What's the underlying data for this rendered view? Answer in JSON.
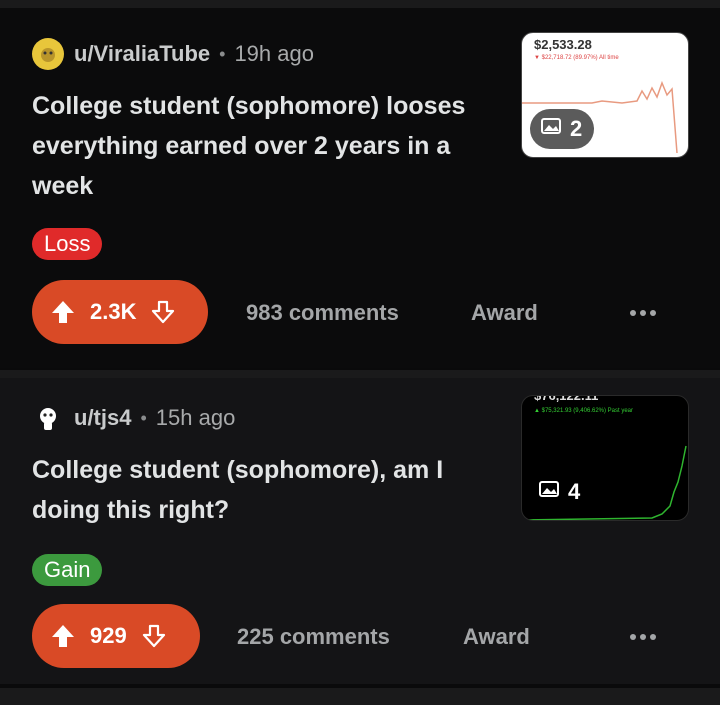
{
  "posts": [
    {
      "username": "u/ViraliaTube",
      "time": "19h ago",
      "title": "College student (sophomore) looses everything earned over 2 years in a week",
      "flair": "Loss",
      "votes": "2.3K",
      "comments": "983 comments",
      "award": "Award",
      "thumbnail": {
        "price": "$2,533.28",
        "change": "▼ $22,718.72 (89.97%) All time",
        "image_count": "2"
      }
    },
    {
      "username": "u/tjs4",
      "time": "15h ago",
      "title": "College student (sophomore), am I doing this right?",
      "flair": "Gain",
      "votes": "929",
      "comments": "225 comments",
      "award": "Award",
      "thumbnail": {
        "price": "$76,122.11",
        "change": "▲ $75,321.93 (9,406.62%) Past year",
        "image_count": "4"
      }
    }
  ],
  "colors": {
    "vote_bg": "#d94a26",
    "loss_flair": "#e02a2a",
    "gain_flair": "#3c9a3e"
  },
  "icons": [
    "upvote-arrow-icon",
    "downvote-arrow-icon",
    "image-gallery-icon",
    "more-options-icon"
  ]
}
